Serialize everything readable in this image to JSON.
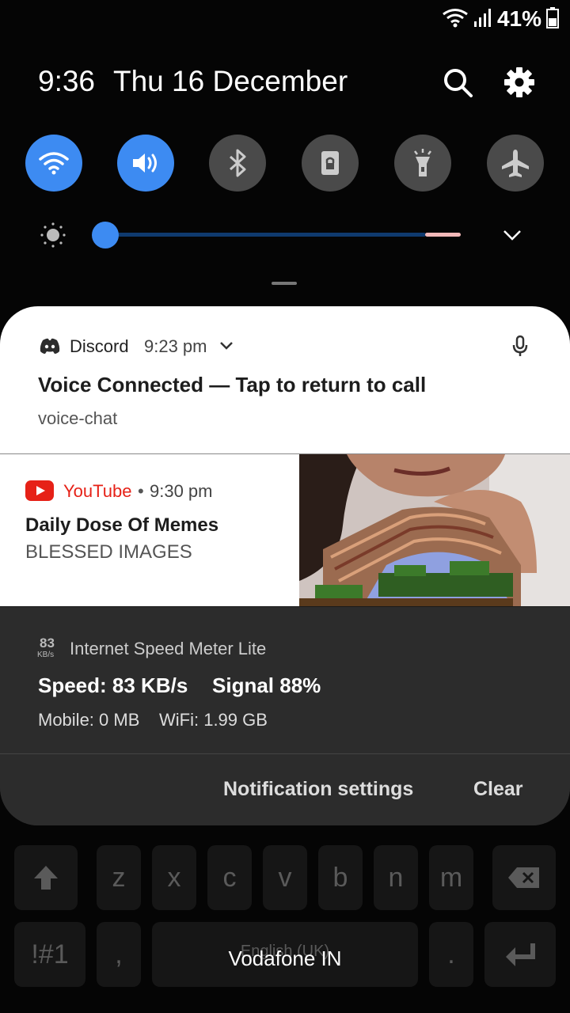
{
  "status_bar": {
    "battery_percent": "41%"
  },
  "header": {
    "time": "9:36",
    "date": "Thu 16 December"
  },
  "quick_tiles": [
    {
      "name": "wifi",
      "on": true
    },
    {
      "name": "sound",
      "on": true
    },
    {
      "name": "bluetooth",
      "on": false
    },
    {
      "name": "screen-lock",
      "on": false
    },
    {
      "name": "flashlight",
      "on": false
    },
    {
      "name": "airplane-mode",
      "on": false
    }
  ],
  "brightness": {
    "level": 0.0
  },
  "notifications": {
    "discord": {
      "app": "Discord",
      "time": "9:23 pm",
      "title": "Voice Connected — Tap to return to call",
      "text": "voice-chat"
    },
    "youtube": {
      "app": "YouTube",
      "time": "9:30 pm",
      "title": "Daily Dose Of Memes",
      "text": "BLESSED IMAGES"
    },
    "speed_meter": {
      "icon_value": "83",
      "icon_unit": "KB/s",
      "app": "Internet Speed Meter Lite",
      "speed": "Speed: 83 KB/s",
      "signal": "Signal 88%",
      "mobile": "Mobile: 0 MB",
      "wifi": "WiFi: 1.99 GB"
    }
  },
  "footer": {
    "settings_label": "Notification settings",
    "clear_label": "Clear"
  },
  "keyboard": {
    "row2": [
      "z",
      "x",
      "c",
      "v",
      "b",
      "n",
      "m"
    ],
    "symbols_label": "!#1",
    "comma": ",",
    "period": ".",
    "space_label": "English (UK)"
  },
  "carrier": "Vodafone IN",
  "colors": {
    "accent": "#3d8bf2",
    "youtube_red": "#e62117"
  }
}
